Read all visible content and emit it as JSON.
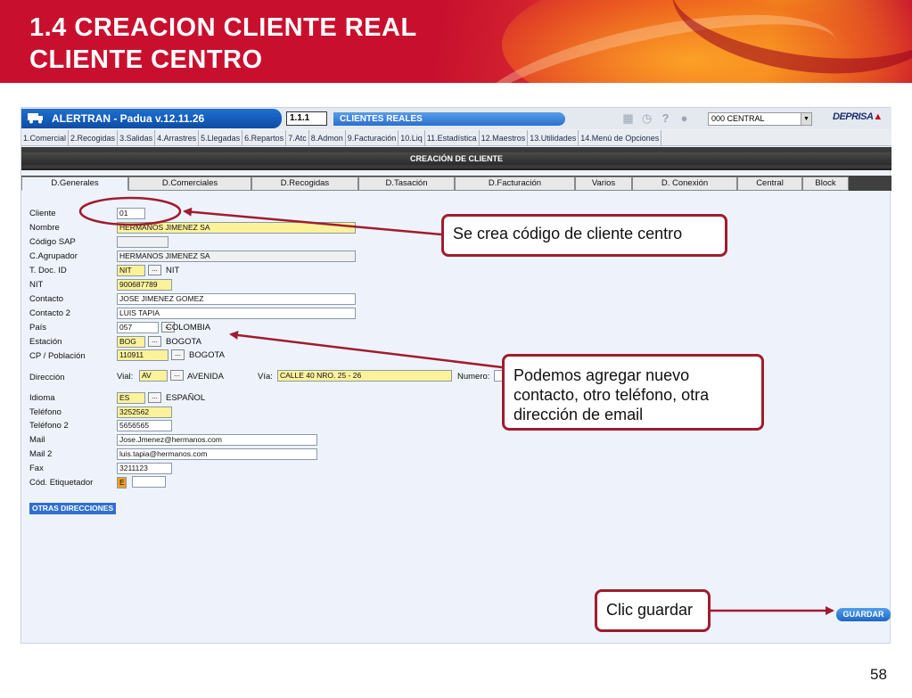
{
  "slide": {
    "title_line1": "1.4 CREACION CLIENTE REAL",
    "title_line2": "CLIENTE CENTRO",
    "page_number": "58"
  },
  "app": {
    "title": "ALERTRAN - Padua  v.12.11.26",
    "module_code": "1.1.1",
    "module_name": "CLIENTES REALES",
    "office": "000 CENTRAL",
    "brand": "DEPRISA",
    "top_icons": [
      "calendar-icon",
      "clock-icon",
      "help-icon",
      "user-icon"
    ]
  },
  "menu": [
    "1.Comercial",
    "2.Recogidas",
    "3.Salidas",
    "4.Arrastres",
    "5.Llegadas",
    "6.Repartos",
    "7.Atc",
    "8.Admon",
    "9.Facturación",
    "10.Liq",
    "11.Estadística",
    "12.Maestros",
    "13.Utilidades",
    "14.Menú de Opciones"
  ],
  "section_title": "CREACIÓN DE CLIENTE",
  "tabs": [
    "D.Generales",
    "D.Comerciales",
    "D.Recogidas",
    "D.Tasación",
    "D.Facturación",
    "Varios",
    "D. Conexión",
    "Central",
    "Block"
  ],
  "form": {
    "labels": {
      "cliente": "Cliente",
      "nombre": "Nombre",
      "codigo_sap": "Código SAP",
      "c_agrupador": "C.Agrupador",
      "t_doc_id": "T. Doc. ID",
      "nit": "NIT",
      "contacto": "Contacto",
      "contacto2": "Contacto 2",
      "pais": "País",
      "estacion": "Estación",
      "cp_poblacion": "CP / Población",
      "direccion": "Dirección",
      "vial": "Vial:",
      "via": "Vía:",
      "numero": "Numero:",
      "idioma": "Idioma",
      "telefono": "Teléfono",
      "telefono2": "Teléfono 2",
      "mail": "Mail",
      "mail2": "Mail 2",
      "fax": "Fax",
      "cod_etiquetador": "Cód. Etiquetador"
    },
    "values": {
      "cliente": "01",
      "nombre": "HERMANOS JIMENEZ SA",
      "codigo_sap": "",
      "c_agrupador": "HERMANOS JIMENEZ SA",
      "t_doc_id": "NIT",
      "t_doc_id_desc": "NIT",
      "nit": "900687789",
      "contacto": "JOSE JIMENEZ GOMEZ",
      "contacto2": "LUIS TAPIA",
      "pais": "057",
      "pais_desc": "COLOMBIA",
      "estacion": "BOG",
      "estacion_desc": "BOGOTA",
      "cp_poblacion": "110911",
      "cp_poblacion_desc": "BOGOTA",
      "vial": "AV",
      "vial_desc": "AVENIDA",
      "via": "CALLE 40 NRO. 25 - 26",
      "numero": "",
      "idioma": "ES",
      "idioma_desc": "ESPAÑOL",
      "telefono": "3252562",
      "telefono2": "5656565",
      "mail": "Jose.Jmenez@hermanos.com",
      "mail2": "luis.tapia@hermanos.com",
      "fax": "3211123",
      "cod_etiquetador": "E",
      "cod_etiquetador_extra": ""
    },
    "lookup_label": "..."
  },
  "buttons": {
    "otras_direcciones": "OTRAS DIRECCIONES",
    "guardar": "GUARDAR"
  },
  "callouts": {
    "c1": "Se crea código de cliente centro",
    "c2": "Podemos agregar nuevo contacto, otro teléfono, otra dirección de email",
    "c3": "Clic guardar"
  },
  "colors": {
    "accent_red": "#a01c2e",
    "header_red": "#c8102e",
    "field_yellow": "#fbf29a",
    "button_blue": "#1f67c6"
  }
}
